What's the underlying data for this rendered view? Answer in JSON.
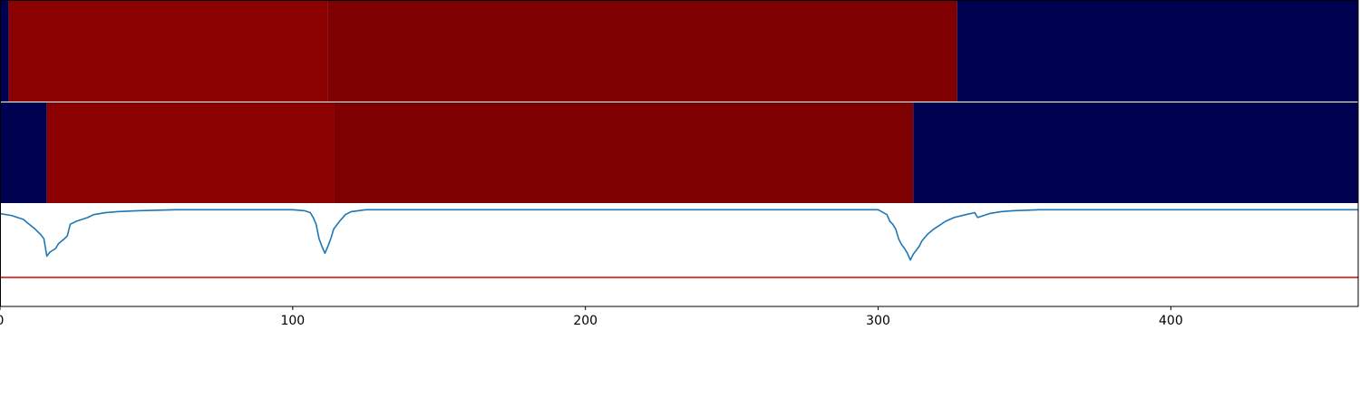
{
  "chart_data": {
    "type": "heatmap",
    "x_ticks": [
      0,
      100,
      200,
      300,
      400
    ],
    "xlim": [
      0,
      464
    ],
    "colors": {
      "low": "#000050",
      "high_bright": "#8b0000",
      "high_dark": "#7f0000",
      "line": "#1f77b4",
      "threshold": "#dd0000",
      "frame": "#000000"
    },
    "tracks": [
      {
        "segments": [
          {
            "start": 0,
            "end": 3,
            "level": "low"
          },
          {
            "start": 3,
            "end": 112,
            "level": "high_bright"
          },
          {
            "start": 112,
            "end": 327,
            "level": "high_dark"
          },
          {
            "start": 327,
            "end": 464,
            "level": "low"
          }
        ]
      },
      {
        "segments": [
          {
            "start": 0,
            "end": 16,
            "level": "low"
          },
          {
            "start": 16,
            "end": 114,
            "level": "high_bright"
          },
          {
            "start": 114,
            "end": 312,
            "level": "high_dark"
          },
          {
            "start": 312,
            "end": 464,
            "level": "low"
          }
        ]
      }
    ],
    "line_panel": {
      "ylim": [
        -1.0,
        0.05
      ],
      "threshold": -0.7,
      "points": [
        [
          0,
          -0.04
        ],
        [
          4,
          -0.06
        ],
        [
          8,
          -0.1
        ],
        [
          10,
          -0.15
        ],
        [
          12,
          -0.2
        ],
        [
          14,
          -0.26
        ],
        [
          15,
          -0.3
        ],
        [
          16,
          -0.48
        ],
        [
          17,
          -0.44
        ],
        [
          19,
          -0.4
        ],
        [
          20,
          -0.35
        ],
        [
          22,
          -0.3
        ],
        [
          23,
          -0.27
        ],
        [
          24,
          -0.15
        ],
        [
          26,
          -0.12
        ],
        [
          28,
          -0.1
        ],
        [
          30,
          -0.08
        ],
        [
          32,
          -0.05
        ],
        [
          36,
          -0.03
        ],
        [
          40,
          -0.02
        ],
        [
          47,
          -0.01
        ],
        [
          60,
          0.0
        ],
        [
          100,
          0.0
        ],
        [
          104,
          -0.01
        ],
        [
          106,
          -0.03
        ],
        [
          107,
          -0.08
        ],
        [
          108,
          -0.15
        ],
        [
          109,
          -0.3
        ],
        [
          110,
          -0.38
        ],
        [
          111,
          -0.45
        ],
        [
          112,
          -0.38
        ],
        [
          113,
          -0.3
        ],
        [
          114,
          -0.2
        ],
        [
          116,
          -0.12
        ],
        [
          118,
          -0.05
        ],
        [
          120,
          -0.02
        ],
        [
          125,
          0.0
        ],
        [
          300,
          0.0
        ],
        [
          303,
          -0.05
        ],
        [
          304,
          -0.12
        ],
        [
          305,
          -0.15
        ],
        [
          306,
          -0.2
        ],
        [
          307,
          -0.3
        ],
        [
          308,
          -0.36
        ],
        [
          309,
          -0.4
        ],
        [
          310,
          -0.45
        ],
        [
          311,
          -0.52
        ],
        [
          312,
          -0.46
        ],
        [
          313,
          -0.42
        ],
        [
          314,
          -0.38
        ],
        [
          315,
          -0.32
        ],
        [
          317,
          -0.25
        ],
        [
          319,
          -0.2
        ],
        [
          321,
          -0.16
        ],
        [
          323,
          -0.12
        ],
        [
          326,
          -0.08
        ],
        [
          330,
          -0.05
        ],
        [
          333,
          -0.03
        ],
        [
          334,
          -0.08
        ],
        [
          336,
          -0.06
        ],
        [
          338,
          -0.04
        ],
        [
          342,
          -0.02
        ],
        [
          346,
          -0.01
        ],
        [
          355,
          0.0
        ],
        [
          464,
          0.0
        ]
      ]
    }
  }
}
